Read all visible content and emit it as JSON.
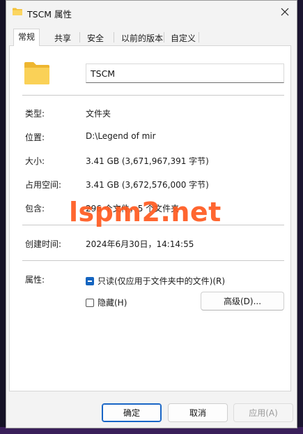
{
  "window": {
    "title": "TSCM 属性"
  },
  "tabs": [
    {
      "label": "常规",
      "active": true
    },
    {
      "label": "共享",
      "active": false
    },
    {
      "label": "安全",
      "active": false
    },
    {
      "label": "以前的版本",
      "active": false
    },
    {
      "label": "自定义",
      "active": false
    }
  ],
  "general": {
    "folder_name": "TSCM",
    "type_label": "类型:",
    "type_value": "文件夹",
    "location_label": "位置:",
    "location_value": "D:\\Legend of mir",
    "size_label": "大小:",
    "size_value": "3.41 GB (3,671,967,391 字节)",
    "disk_label": "占用空间:",
    "disk_value": "3.41 GB (3,672,576,000 字节)",
    "contains_label": "包含:",
    "contains_value": "296 个文件，5 个文件夹",
    "created_label": "创建时间:",
    "created_value": "2024年6月30日，14:14:55",
    "attributes_label": "属性:",
    "readonly_label": "只读(仅应用于文件夹中的文件)(R)",
    "readonly_state": "indeterminate",
    "hidden_label": "隐藏(H)",
    "hidden_state": "unchecked",
    "advanced_label": "高级(D)..."
  },
  "buttons": {
    "ok": "确定",
    "cancel": "取消",
    "apply": "应用(A)"
  },
  "watermark": "lspm2.net",
  "colors": {
    "accent": "#1565c0",
    "watermark": "#ff5a1f",
    "folder": "#f6c945"
  }
}
